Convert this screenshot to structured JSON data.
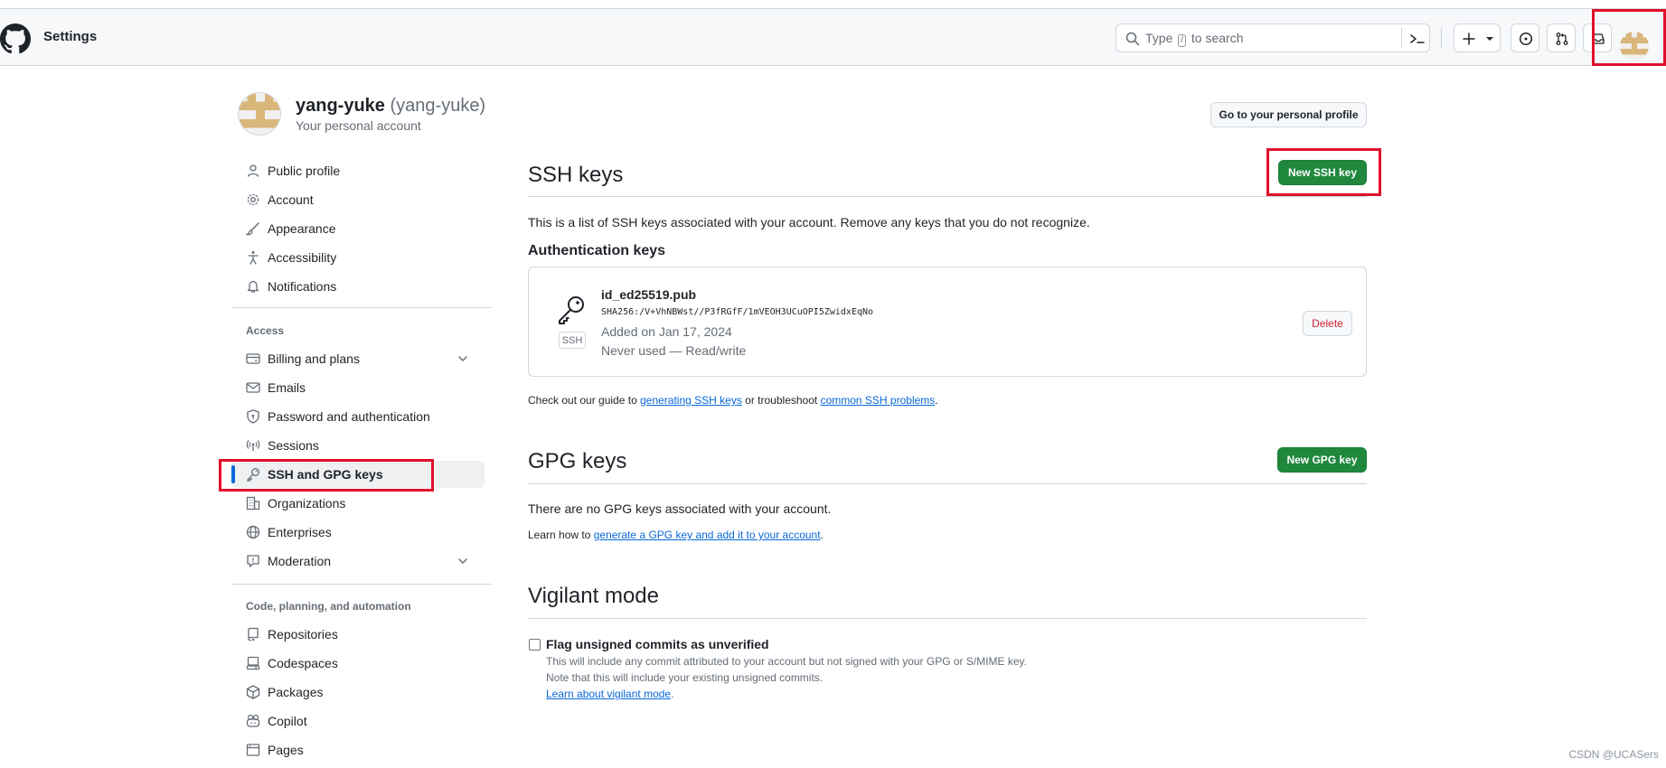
{
  "header": {
    "title": "Settings",
    "search": {
      "prefix": "Type",
      "kbd": "/",
      "suffix": "to search"
    },
    "icons": [
      "github-logo",
      "search-icon",
      "command-palette-icon",
      "plus-icon",
      "issues-icon",
      "pull-requests-icon",
      "inbox-icon"
    ]
  },
  "profile": {
    "name": "yang-yuke",
    "handle": "(yang-yuke)",
    "subtitle": "Your personal account",
    "go_profile_label": "Go to your personal profile"
  },
  "sidebar": {
    "top_items": [
      {
        "label": "Public profile",
        "icon": "person-icon"
      },
      {
        "label": "Account",
        "icon": "gear-icon"
      },
      {
        "label": "Appearance",
        "icon": "paintbrush-icon"
      },
      {
        "label": "Accessibility",
        "icon": "accessibility-icon"
      },
      {
        "label": "Notifications",
        "icon": "bell-icon"
      }
    ],
    "access_heading": "Access",
    "access_items": [
      {
        "label": "Billing and plans",
        "icon": "credit-card-icon"
      },
      {
        "label": "Emails",
        "icon": "mail-icon"
      },
      {
        "label": "Password and authentication",
        "icon": "shield-lock-icon"
      },
      {
        "label": "Sessions",
        "icon": "broadcast-icon"
      },
      {
        "label": "SSH and GPG keys",
        "icon": "key-icon"
      },
      {
        "label": "Organizations",
        "icon": "organization-icon"
      },
      {
        "label": "Enterprises",
        "icon": "globe-icon"
      },
      {
        "label": "Moderation",
        "icon": "report-icon"
      }
    ],
    "code_heading": "Code, planning, and automation",
    "code_items": [
      {
        "label": "Repositories",
        "icon": "repo-icon"
      },
      {
        "label": "Codespaces",
        "icon": "codespaces-icon"
      },
      {
        "label": "Packages",
        "icon": "package-icon"
      },
      {
        "label": "Copilot",
        "icon": "copilot-icon"
      },
      {
        "label": "Pages",
        "icon": "browser-icon"
      }
    ]
  },
  "ssh": {
    "title": "SSH keys",
    "new_button": "New SSH key",
    "description": "This is a list of SSH keys associated with your account. Remove any keys that you do not recognize.",
    "auth_heading": "Authentication keys",
    "key": {
      "name": "id_ed25519.pub",
      "fingerprint": "SHA256:/V+VhNBWst//P3fRGfF/1mVEOH3UCuOPI5ZwidxEqNo",
      "added": "Added on Jan 17, 2024",
      "usage": "Never used — Read/write",
      "badge": "SSH",
      "delete_label": "Delete"
    },
    "guide": {
      "prefix": "Check out our guide to",
      "link1": "generating SSH keys",
      "middle": "or troubleshoot",
      "link2": "common SSH problems",
      "suffix": "."
    }
  },
  "gpg": {
    "title": "GPG keys",
    "new_button": "New GPG key",
    "empty_text": "There are no GPG keys associated with your account.",
    "learn_prefix": "Learn how to",
    "learn_link": "generate a GPG key and add it to your account",
    "learn_suffix": "."
  },
  "vigilant": {
    "title": "Vigilant mode",
    "checkbox_label": "Flag unsigned commits as unverified",
    "note1": "This will include any commit attributed to your account but not signed with your GPG or S/MIME key.",
    "note2": "Note that this will include your existing unsigned commits.",
    "link": "Learn about vigilant mode",
    "link_suffix": "."
  },
  "watermark": "CSDN @UCASers",
  "colors": {
    "accent": "#0969da",
    "primary_button": "#1f883d",
    "danger": "#cf222e",
    "highlight_box": "#e0102a"
  }
}
